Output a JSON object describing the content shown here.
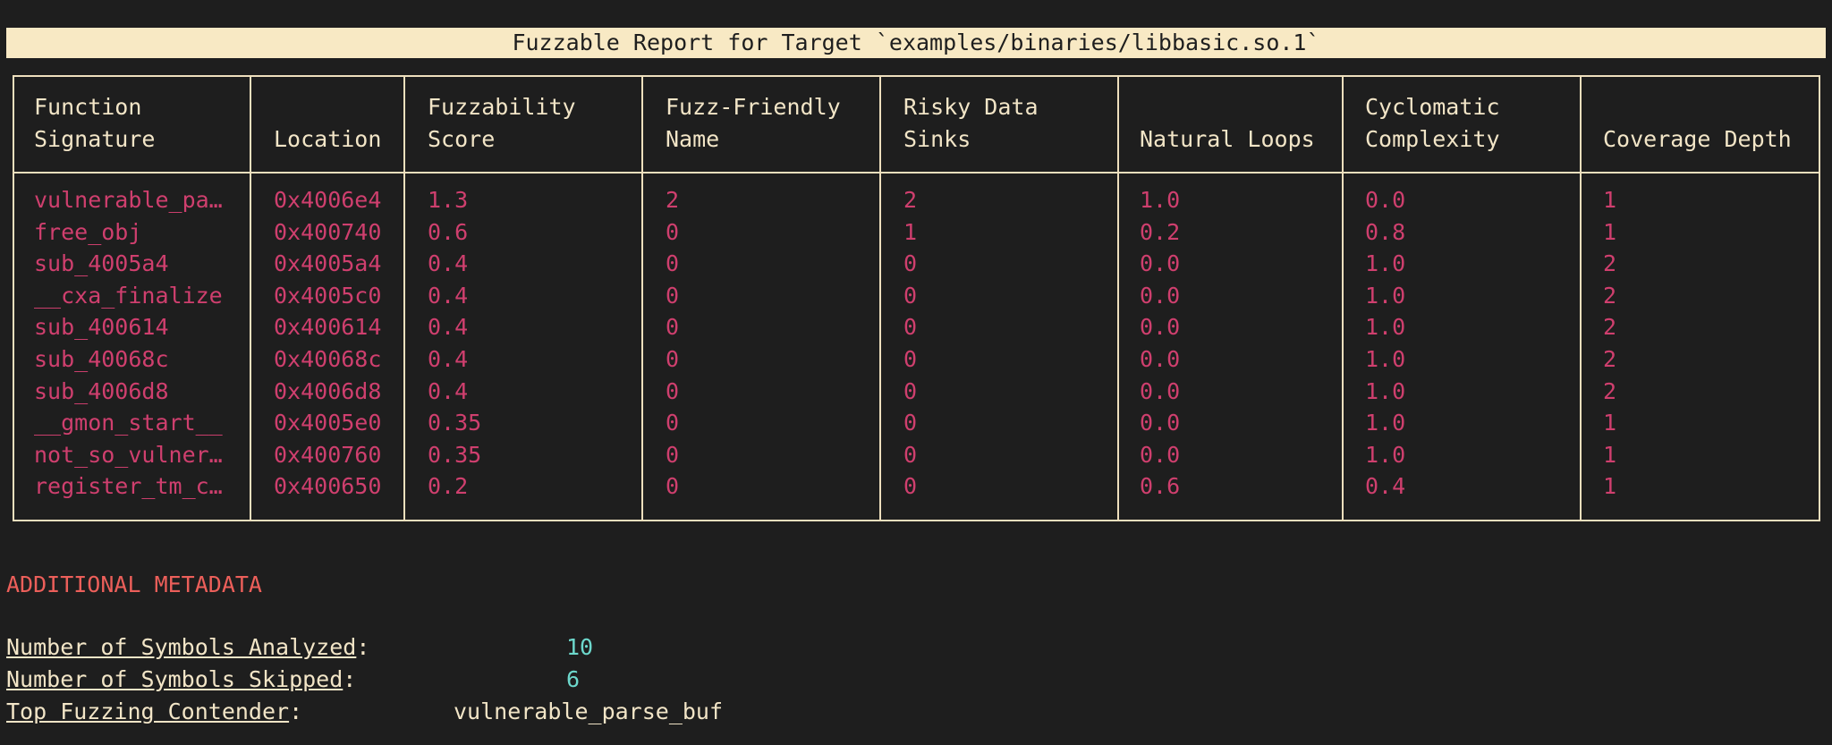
{
  "title": "Fuzzable Report for Target `examples/binaries/libbasic.so.1`",
  "table": {
    "headers": [
      "Function\nSignature",
      "Location",
      "Fuzzability\nScore",
      "Fuzz-Friendly\nName",
      "Risky Data\nSinks",
      "Natural Loops",
      "Cyclomatic\nComplexity",
      "Coverage Depth"
    ],
    "rows": [
      [
        "vulnerable_pa…",
        "0x4006e4",
        "1.3",
        "2",
        "2",
        "1.0",
        "0.0",
        "1"
      ],
      [
        "free_obj",
        "0x400740",
        "0.6",
        "0",
        "1",
        "0.2",
        "0.8",
        "1"
      ],
      [
        "sub_4005a4",
        "0x4005a4",
        "0.4",
        "0",
        "0",
        "0.0",
        "1.0",
        "2"
      ],
      [
        "__cxa_finalize",
        "0x4005c0",
        "0.4",
        "0",
        "0",
        "0.0",
        "1.0",
        "2"
      ],
      [
        "sub_400614",
        "0x400614",
        "0.4",
        "0",
        "0",
        "0.0",
        "1.0",
        "2"
      ],
      [
        "sub_40068c",
        "0x40068c",
        "0.4",
        "0",
        "0",
        "0.0",
        "1.0",
        "2"
      ],
      [
        "sub_4006d8",
        "0x4006d8",
        "0.4",
        "0",
        "0",
        "0.0",
        "1.0",
        "2"
      ],
      [
        "__gmon_start__",
        "0x4005e0",
        "0.35",
        "0",
        "0",
        "0.0",
        "1.0",
        "1"
      ],
      [
        "not_so_vulner…",
        "0x400760",
        "0.35",
        "0",
        "0",
        "0.0",
        "1.0",
        "1"
      ],
      [
        "register_tm_c…",
        "0x400650",
        "0.2",
        "0",
        "0",
        "0.6",
        "0.4",
        "1"
      ]
    ]
  },
  "metadata": {
    "heading": "ADDITIONAL METADATA",
    "symbols_analyzed_label": "Number of Symbols Analyzed",
    "symbols_analyzed_value": "10",
    "symbols_skipped_label": "Number of Symbols Skipped",
    "symbols_skipped_value": "6",
    "top_contender_label": "Top Fuzzing Contender",
    "top_contender_value": "vulnerable_parse_buf",
    "colon": ":"
  },
  "colors": {
    "background": "#1e1e1e",
    "title_bar": "#f8e9c4",
    "border": "#eedfbd",
    "text": "#f2e5c7",
    "cell_text": "#cf3f6e",
    "heading": "#ec5f5a",
    "number": "#6dd8cc"
  }
}
